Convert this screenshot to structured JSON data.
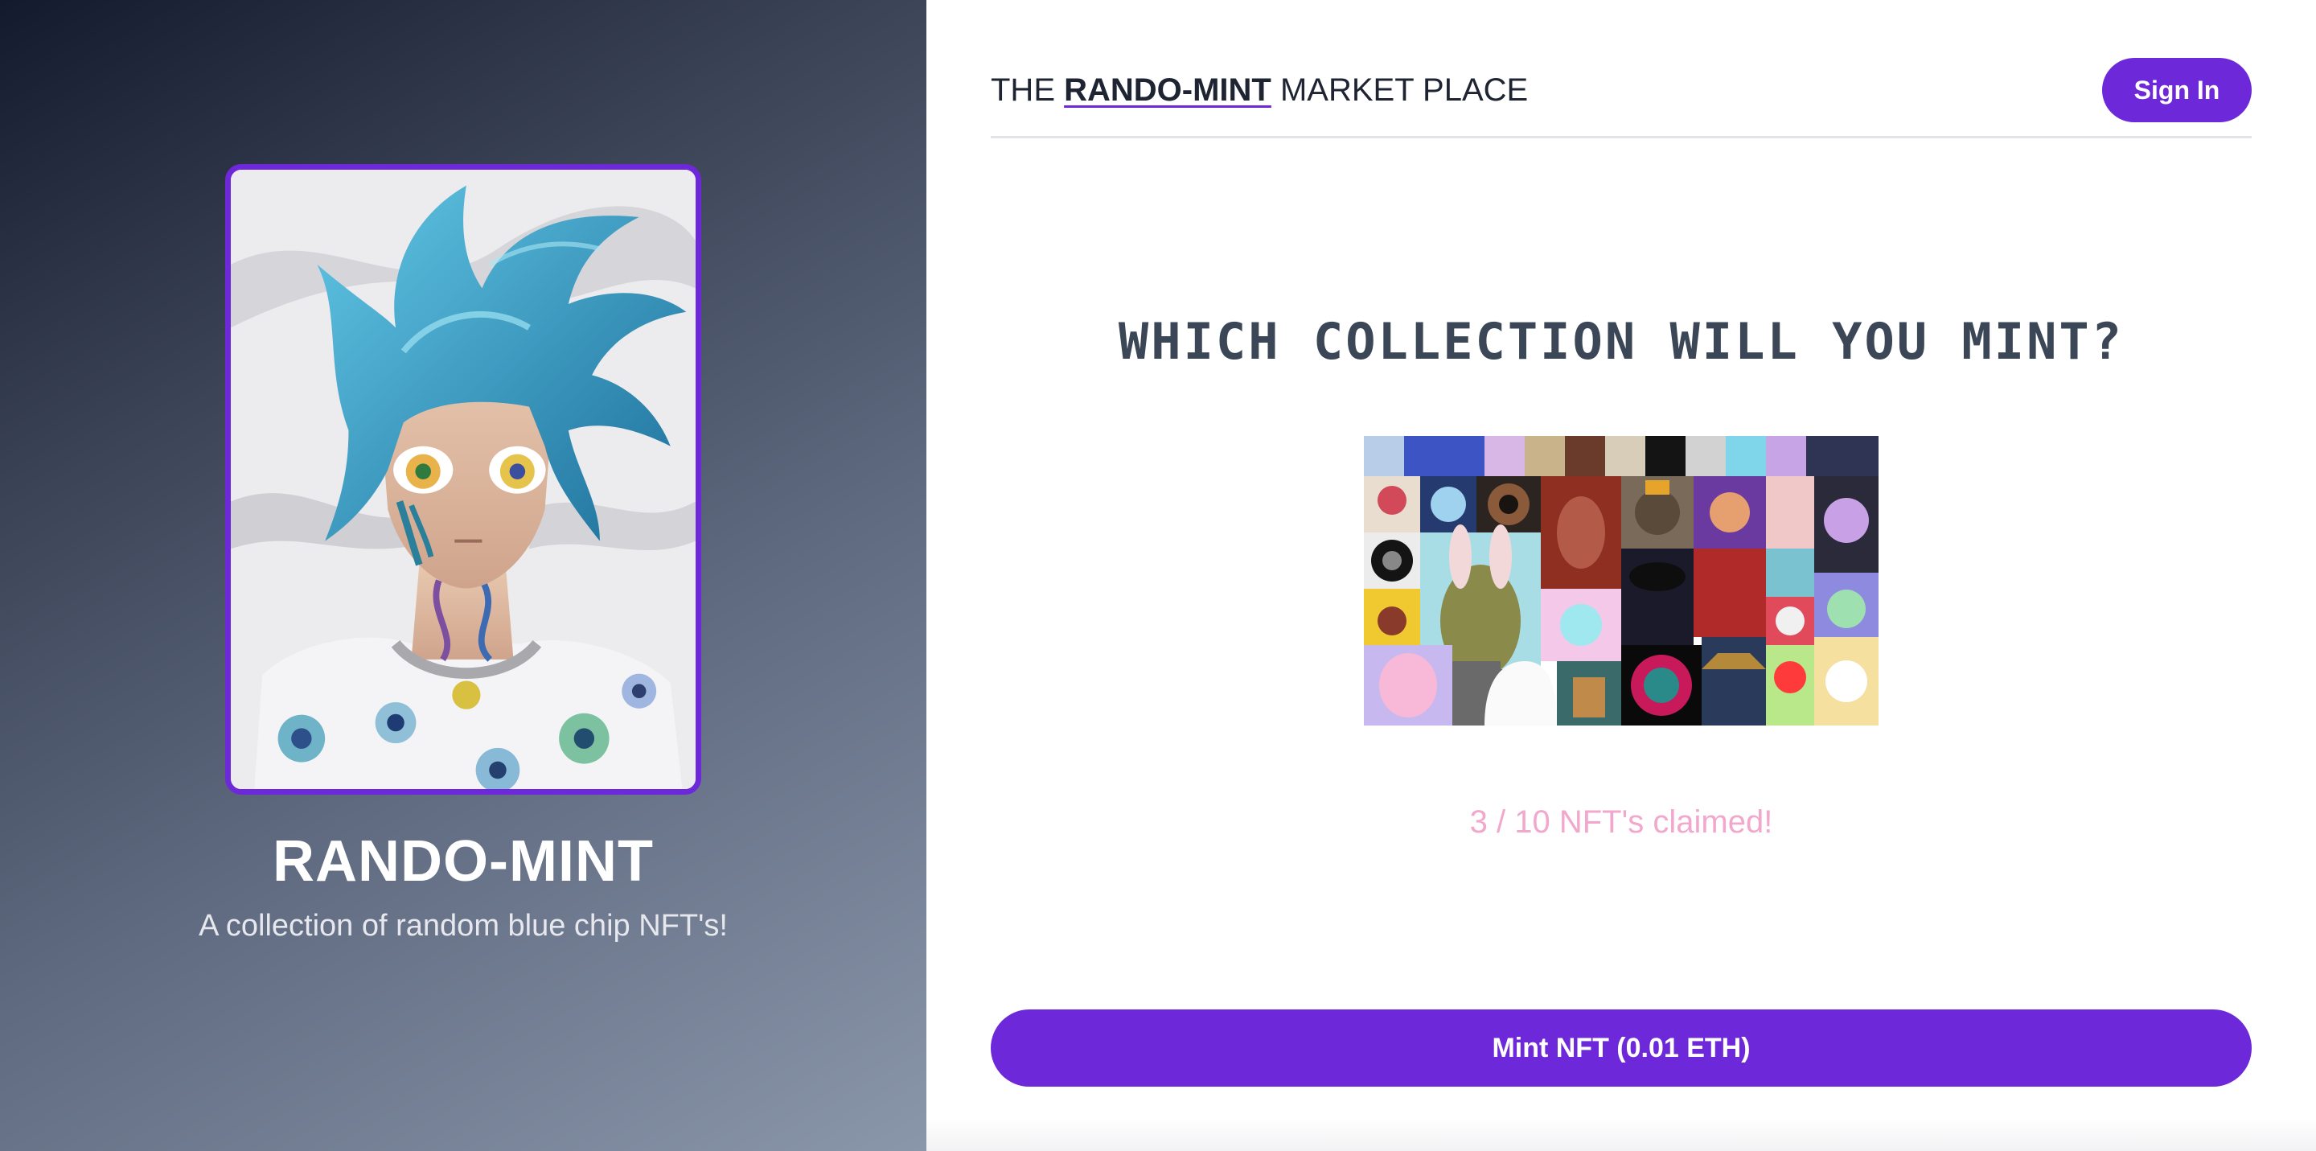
{
  "brand": {
    "prefix": "THE",
    "name": "RANDO-MINT",
    "suffix": "MARKET PLACE"
  },
  "header": {
    "sign_in_label": "Sign In"
  },
  "collection": {
    "title": "RANDO-MINT",
    "subtitle": "A collection of random blue chip NFT's!"
  },
  "main": {
    "headline": "WHICH COLLECTION WILL YOU MINT?",
    "claimed_text": "3 / 10 NFT's claimed!",
    "mint_button_label": "Mint NFT (0.01 ETH)"
  },
  "colors": {
    "accent": "#6d28d9",
    "claimed_text": "#f2a7cd",
    "headline": "#3b4656"
  }
}
